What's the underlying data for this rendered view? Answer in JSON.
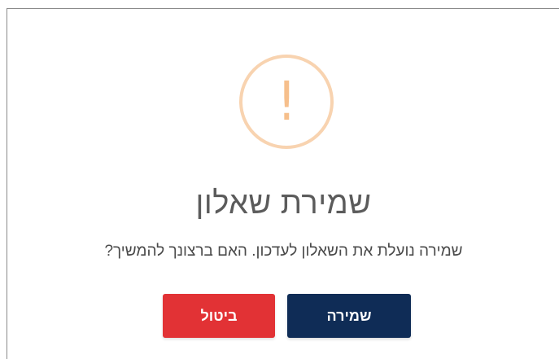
{
  "dialog": {
    "icon": "warning-exclamation-icon",
    "icon_glyph": "!",
    "title": "שמירת שאלון",
    "message": "שמירה נועלת את השאלון לעדכון. האם ברצונך להמשיך?",
    "buttons": {
      "save_label": "שמירה",
      "cancel_label": "ביטול"
    }
  },
  "colors": {
    "icon_ring": "#f8d3b0",
    "icon_mark": "#f6bf8c",
    "save_button": "#0f2c56",
    "cancel_button": "#e23235",
    "title_text": "#5b5b5b"
  }
}
